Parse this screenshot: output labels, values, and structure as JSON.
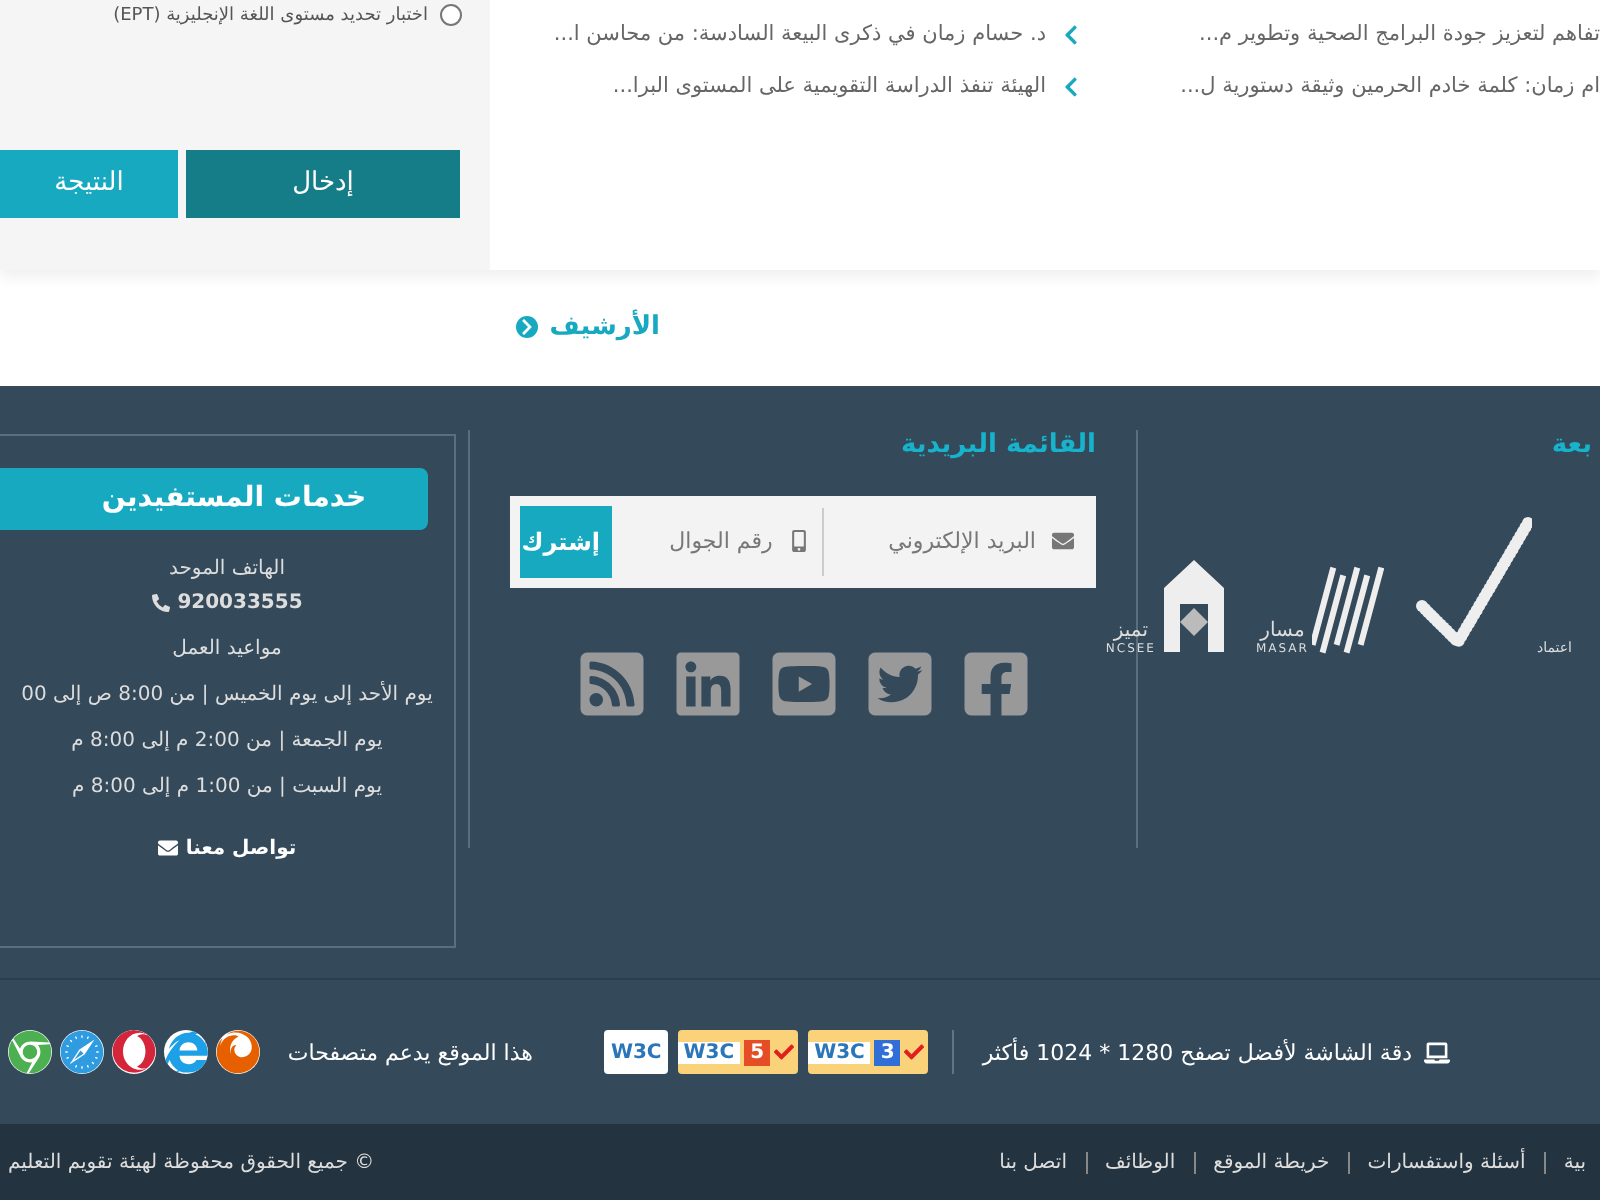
{
  "test_option": {
    "label": "اختبار تحديد مستوى اللغة الإنجليزية (EPT)",
    "selected": false
  },
  "result_buttons": [
    {
      "label": "إدخال",
      "kind": "dark"
    },
    {
      "label": "النتيجة",
      "kind": "light"
    }
  ],
  "news_columns": [
    {
      "items": [
        {
          "title": "تفاهم لتعزيز جودة البرامج الصحية وتطوير م...",
          "chevron": false
        },
        {
          "title": "ام زمان: كلمة خادم الحرمين وثيقة دستورية ل...",
          "chevron": false
        }
      ]
    },
    {
      "items": [
        {
          "title": "د. حسام زمان في ذكرى البيعة السادسة: من محاسن ا...",
          "chevron": true
        },
        {
          "title": "الهيئة تنفذ الدراسة التقويمية على المستوى البرا...",
          "chevron": true
        }
      ]
    }
  ],
  "archive_link": "الأرشيف",
  "footer": {
    "accreditation": {
      "heading": "بعة",
      "logos": [
        {
          "kind": "check",
          "name": "اعتماد"
        },
        {
          "kind": "stripes",
          "name": "مسار",
          "latin": "MASAR"
        },
        {
          "kind": "house",
          "name": "تميز",
          "latin": "NCSEE"
        }
      ]
    },
    "mailing_list": {
      "heading": "القائمة البريدية",
      "email_placeholder": "البريد الإلكتروني",
      "phone_placeholder": "رقم الجوال",
      "subscribe": "إشترك",
      "social": [
        {
          "kind": "facebook"
        },
        {
          "kind": "twitter"
        },
        {
          "kind": "youtube"
        },
        {
          "kind": "linkedin"
        },
        {
          "kind": "rss"
        }
      ]
    },
    "services": {
      "heading": "خدمات المستفيدين",
      "phone_label": "الهاتف الموحد",
      "phone": "920033555",
      "hours_label": "مواعيد العمل",
      "hours": [
        "يوم الأحد إلى يوم الخميس | من 8:00 ص إلى 00",
        "يوم الجمعة | من 2:00 م إلى 8:00 م",
        "يوم السبت | من 1:00 م إلى 8:00 م"
      ],
      "contact": "تواصل معنا"
    }
  },
  "info_bar": {
    "resolution": "دقة الشاشة لأفضل تصفح 1280 * 1024 فأكثر",
    "badges": [
      {
        "kind": "css3",
        "label": "W3C",
        "mark": "3"
      },
      {
        "kind": "html5",
        "label": "W3C",
        "mark": "5"
      },
      {
        "kind": "plain",
        "label": "W3C"
      }
    ],
    "browsers_label": "هذا الموقع يدعم متصفحات",
    "browsers": [
      {
        "kind": "firefox"
      },
      {
        "kind": "ie"
      },
      {
        "kind": "opera"
      },
      {
        "kind": "safari"
      },
      {
        "kind": "chrome"
      }
    ]
  },
  "bottom_bar": {
    "links": [
      "بية",
      "أسئلة واستفسارات",
      "خريطة الموقع",
      "الوظائف",
      "اتصل بنا"
    ],
    "copyright": "© جميع الحقوق محفوظة لهيئة تقويم التعليم"
  }
}
